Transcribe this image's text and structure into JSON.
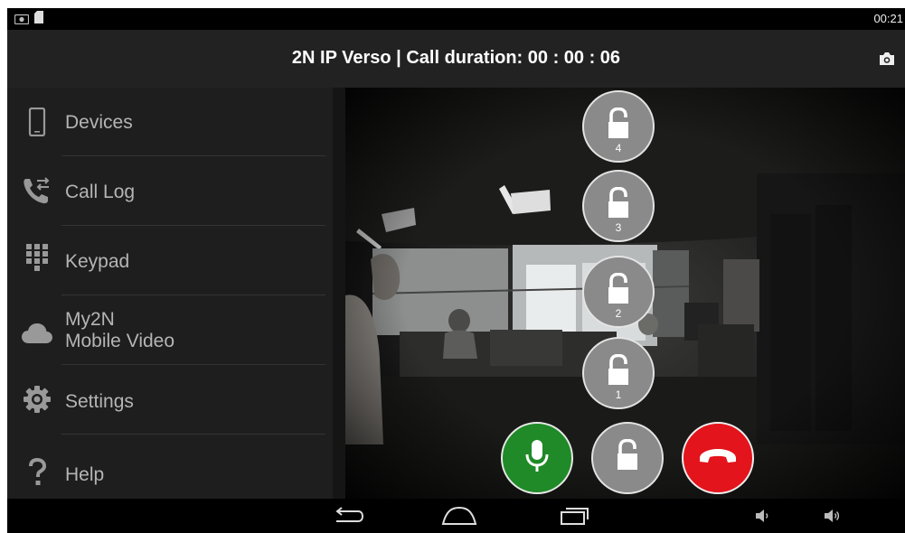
{
  "status_bar": {
    "clock": "00:21",
    "icons": [
      "photo-icon",
      "sd-card-icon"
    ]
  },
  "header": {
    "title": "2N IP Verso | Call duration: 00 : 00 : 06",
    "action_icon": "camera-icon"
  },
  "sidebar": {
    "items": [
      {
        "label": "Devices",
        "icon": "phone-device-icon"
      },
      {
        "label": "Call Log",
        "icon": "call-log-icon"
      },
      {
        "label": "Keypad",
        "icon": "keypad-icon"
      },
      {
        "label": "My2N\nMobile Video",
        "icon": "cloud-icon"
      },
      {
        "label": "Settings",
        "icon": "gear-icon"
      },
      {
        "label": "Help",
        "icon": "help-icon"
      }
    ]
  },
  "call_controls": {
    "locks": [
      "4",
      "3",
      "2",
      "1"
    ],
    "mic_icon": "microphone-icon",
    "unlock_icon": "unlock-icon",
    "hangup_icon": "hang-up-icon",
    "colors": {
      "mic": "#1f8a27",
      "hangup": "#e3141c",
      "lock": "#8a8a8a"
    }
  },
  "system_nav": {
    "buttons": [
      "back-icon",
      "home-icon",
      "recent-apps-icon",
      "volume-down-icon",
      "volume-up-icon"
    ]
  }
}
